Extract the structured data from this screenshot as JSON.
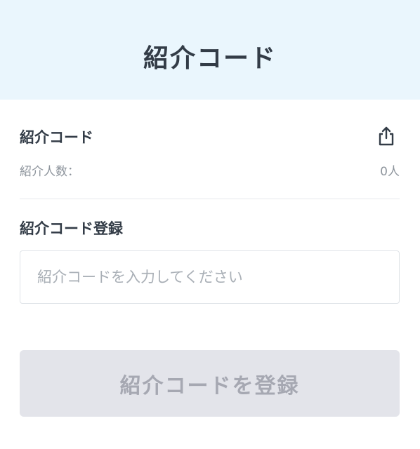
{
  "header": {
    "title": "紹介コード"
  },
  "referral": {
    "code_label": "紹介コード",
    "count_label": "紹介人数：",
    "count_value": "0人"
  },
  "register": {
    "label": "紹介コード登録",
    "input_placeholder": "紹介コードを入力してください",
    "input_value": "",
    "button_label": "紹介コードを登録",
    "button_disabled": true
  },
  "icons": {
    "share": "share-icon"
  },
  "colors": {
    "header_bg": "#eaf6fd",
    "title_text": "#333c47",
    "muted_text": "#8d949c",
    "button_disabled_bg": "#e3e4ea",
    "button_disabled_text": "#a6a8b2"
  }
}
